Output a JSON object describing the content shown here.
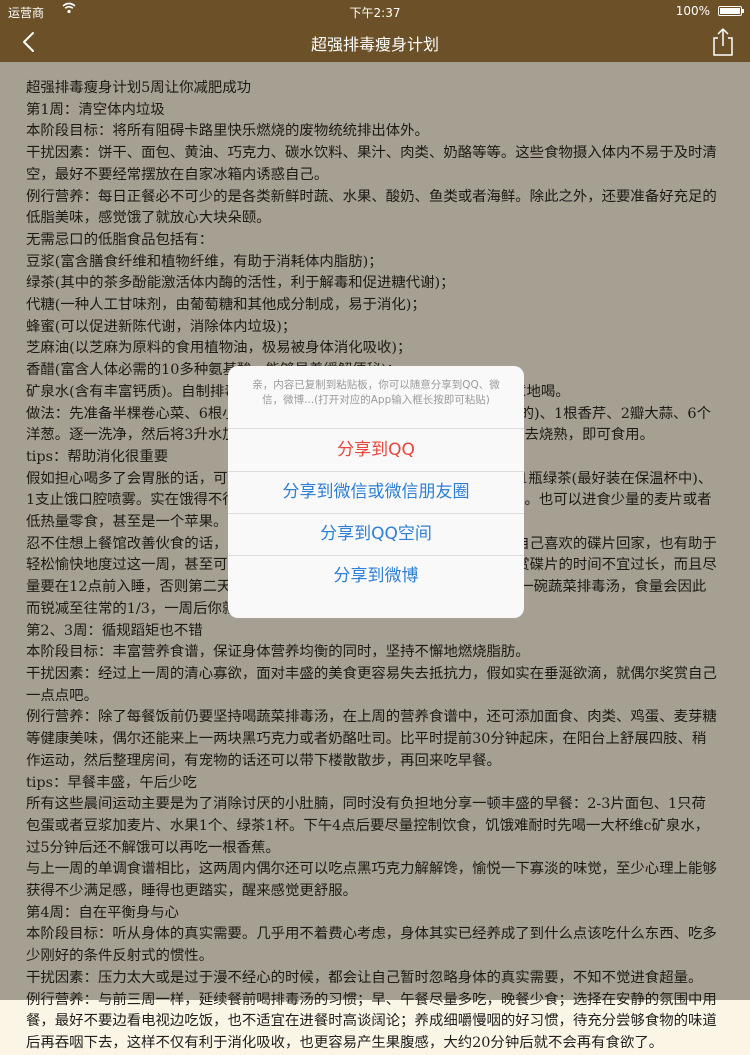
{
  "status_bar": {
    "carrier": "运营商",
    "time": "下午2:37",
    "battery": "100%"
  },
  "nav": {
    "title": "超强排毒瘦身计划"
  },
  "article": {
    "paragraphs": [
      "超强排毒瘦身计划5周让你减肥成功",
      "第1周：清空体内垃圾",
      "本阶段目标：将所有阻碍卡路里快乐燃烧的废物统统排出体外。",
      "干扰因素：饼干、面包、黄油、巧克力、碳水饮料、果汁、肉类、奶酪等等。这些食物摄入体内不易于及时清空，最好不要经常摆放在自家冰箱内诱惑自己。",
      "例行营养：每日正餐必不可少的是各类新鲜时蔬、水果、酸奶、鱼类或者海鲜。除此之外，还要准备好充足的低脂美味，感觉饿了就放心大块朵颐。",
      "无需忌口的低脂食品包括有：",
      "豆浆(富含膳食纤维和植物纤维，有助于消耗体内脂肪)；",
      "绿茶(其中的茶多酚能激活体内酶的活性，利于解毒和促进糖代谢)；",
      "代糖(一种人工甘味剂，由葡萄糖和其他成分制成，易于消化)；",
      "蜂蜜(可以促进新陈代谢，消除体内垃圾)；",
      "芝麻油(以芝麻为原料的食用植物油，极易被身体消化吸收)；",
      "香醋(富含人体必需的10多种氨基酸，能够显着缓解便秘)；",
      "矿泉水(含有丰富钙质)。自制排毒汤餐前先喝上一碗，正式用餐时可按需要随意地喝。",
      "做法：先准备半棵卷心菜、6根小胡萝卜、2个绿辣椒、3根芹菜(都要切成小片的)、1根香芹、2瓣大蒜、6个洋葱。逐一洗净，然后将3升水加入锅中，放入准备好的全部材料，加盐后放进去烧熟，即可食用。",
      "tips：帮助消化很重要",
      "假如担心喝多了会胃胀的话，可以在背包中随时准备好1瓶矿泉水、1瓶绿茶和1瓶绿茶(最好装在保温杯中)、1支止饿口腔喷雾。实在饿得不行的时候，就可以用这些低热量的饮料来充充饥。也可以进食少量的麦片或者低热量零食，甚至是一个苹果。",
      "忍不住想上餐馆改善伙食的话，那就建议您点一份清淡的蔬菜沙拉，或者买上自己喜欢的碟片回家，也有助于轻松愉快地度过这一周，甚至可以在家看电影的同时做做运动，不过要注意欣赏碟片的时间不宜过长，而且尽量要在12点前入睡，否则第二天早上起来会感觉特别饿。每天三餐前都要喝上一碗蔬菜排毒汤，食量会因此而锐减至往常的1/3，一周后你就可以明显看出效果。",
      "第2、3周：循规蹈矩也不错",
      "本阶段目标：丰富营养食谱，保证身体营养均衡的同时，坚持不懈地燃烧脂肪。",
      "干扰因素：经过上一周的清心寡欲，面对丰盛的美食更容易失去抵抗力，假如实在垂涎欲滴，就偶尔奖赏自己一点点吧。",
      "例行营养：除了每餐饭前仍要坚持喝蔬菜排毒汤，在上周的营养食谱中，还可添加面食、肉类、鸡蛋、麦芽糖等健康美味，偶尔还能来上一两块黑巧克力或者奶酪吐司。比平时提前30分钟起床，在阳台上舒展四肢、稍作运动，然后整理房间，有宠物的话还可以带下楼散散步，再回来吃早餐。",
      "tips：早餐丰盛，午后少吃",
      "所有这些晨间运动主要是为了消除讨厌的小肚腩，同时没有负担地分享一顿丰盛的早餐：2-3片面包、1只荷包蛋或者豆浆加麦片、水果1个、绿茶1杯。下午4点后要尽量控制饮食，饥饿难耐时先喝一大杯维c矿泉水，过5分钟后还不解饿可以再吃一根香蕉。",
      "与上一周的单调食谱相比，这两周内偶尔还可以吃点黑巧克力解解馋，愉悦一下寡淡的味觉，至少心理上能够获得不少满足感，睡得也更踏实，醒来感觉更舒服。",
      "第4周：自在平衡身与心",
      "本阶段目标：听从身体的真实需要。几乎用不着费心考虑，身体其实已经养成了到什么点该吃什么东西、吃多少刚好的条件反射式的惯性。",
      "干扰因素：压力太大或是过于漫不经心的时候，都会让自己暂时忽略身体的真实需要，不知不觉进食超量。",
      "例行营养：与前三周一样，延续餐前喝排毒汤的习惯；早、午餐尽量多吃，晚餐少食；选择在安静的氛围中用餐，最好不要边看电视边吃饭，也不适宜在进餐时高谈阔论；养成细嚼慢咽的好习惯，待充分尝够食物的味道后再吞咽下去，这样不仅有利于消化吸收，也更容易产生果腹感，大约20分钟后就不会再有食欲了。"
    ]
  },
  "share_sheet": {
    "message": "亲，内容已复制到粘贴板，你可以随意分享到QQ、微信，微博...(打开对应的App输入框长按即可粘贴)",
    "options": [
      "分享到QQ",
      "分享到微信或微信朋友圈",
      "分享到QQ空间",
      "分享到微博"
    ],
    "colors": {
      "danger": "#e8473d",
      "action": "#2e7fd6"
    }
  }
}
